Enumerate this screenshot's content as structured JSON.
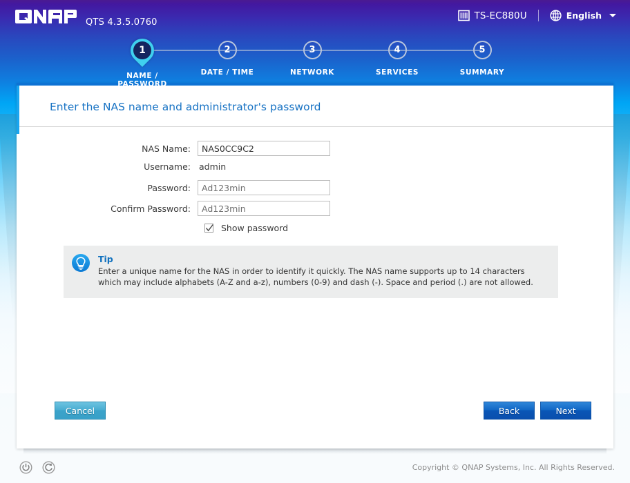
{
  "header": {
    "logo": "QNAP",
    "version": "QTS 4.3.5.0760",
    "model": "TS-EC880U",
    "model_icon": "nas-rack-icon",
    "language": "English",
    "language_icon": "globe-icon",
    "dropdown_icon": "chevron-down-icon"
  },
  "stepper": {
    "steps": [
      {
        "number": "1",
        "label": "NAME / PASSWORD",
        "active": true
      },
      {
        "number": "2",
        "label": "DATE / TIME",
        "active": false
      },
      {
        "number": "3",
        "label": "NETWORK",
        "active": false
      },
      {
        "number": "4",
        "label": "SERVICES",
        "active": false
      },
      {
        "number": "5",
        "label": "SUMMARY",
        "active": false
      }
    ]
  },
  "panel": {
    "title": "Enter the NAS name and administrator's password",
    "accent_color": "#0d72d4"
  },
  "form": {
    "nas_name_label": "NAS Name:",
    "nas_name_value": "NAS0CC9C2",
    "username_label": "Username:",
    "username_value": "admin",
    "password_label": "Password:",
    "password_value": "Ad123min",
    "confirm_password_label": "Confirm Password:",
    "confirm_password_value": "Ad123min",
    "show_password_label": "Show password",
    "show_password_checked": "checked"
  },
  "tip": {
    "icon": "lightbulb-icon",
    "title": "Tip",
    "text": "Enter a unique name for the NAS in order to identify it quickly. The NAS name supports up to 14 characters which may include alphabets (A-Z and a-z), numbers (0-9) and dash (-). Space and period (.) are not allowed."
  },
  "buttons": {
    "cancel": "Cancel",
    "back": "Back",
    "next": "Next"
  },
  "footer": {
    "power_icon": "power-icon",
    "restart_icon": "restart-icon",
    "copyright": "Copyright © QNAP Systems, Inc. All Rights Reserved."
  }
}
